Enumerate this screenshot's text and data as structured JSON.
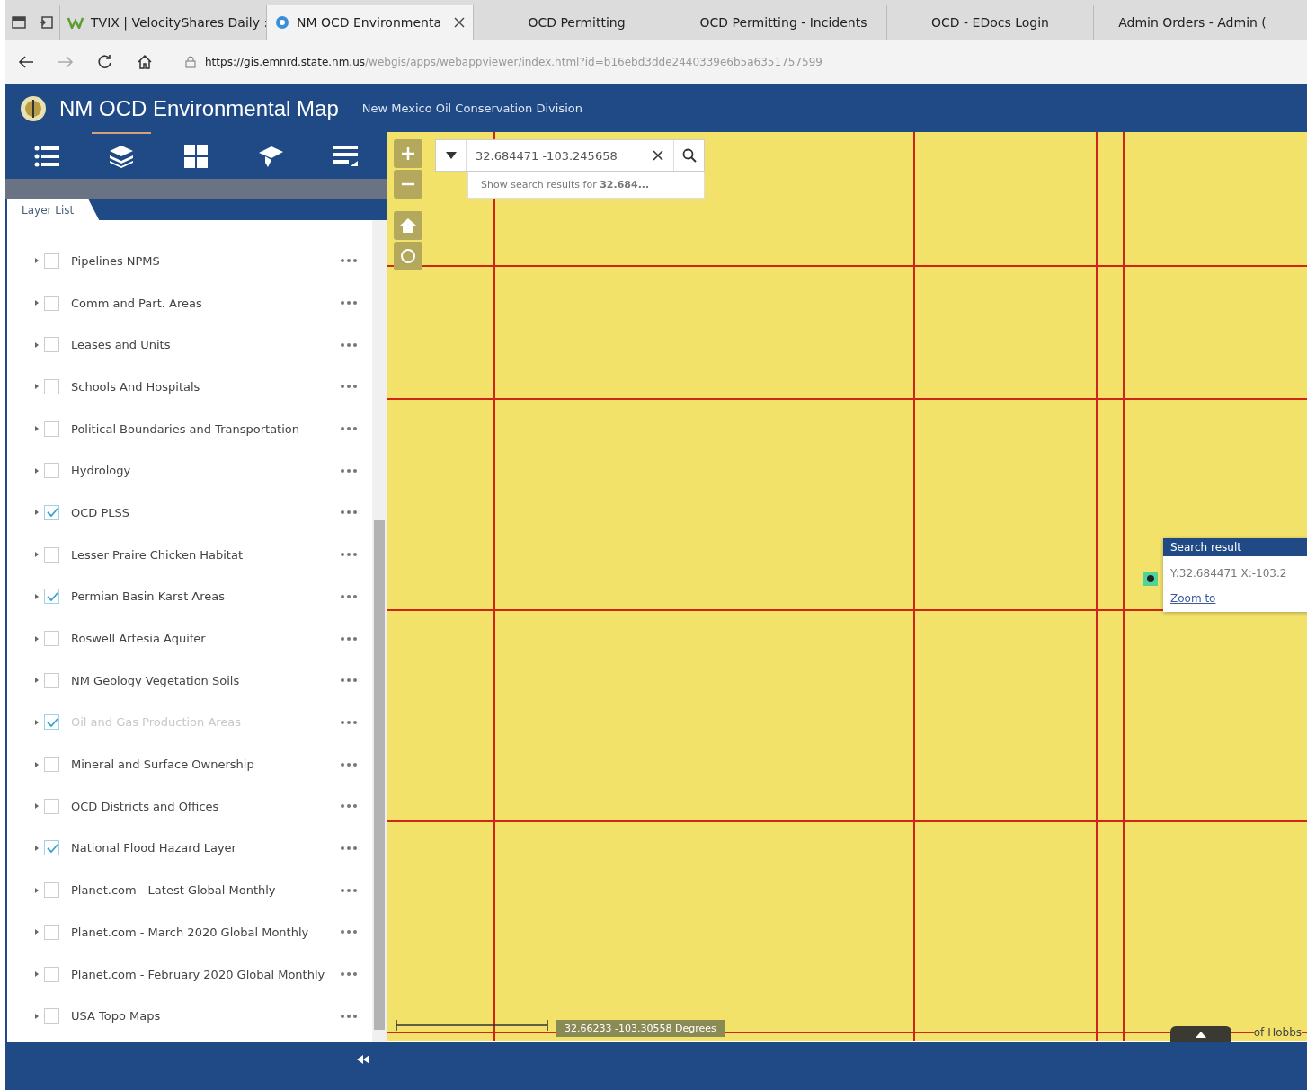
{
  "browser": {
    "tabs": [
      {
        "title": "TVIX | VelocityShares Daily :",
        "selected": false
      },
      {
        "title": "NM OCD Environmenta",
        "selected": true
      },
      {
        "title": "OCD Permitting",
        "selected": false
      },
      {
        "title": "OCD Permitting - Incidents",
        "selected": false
      },
      {
        "title": "OCD - EDocs Login",
        "selected": false
      },
      {
        "title": "Admin Orders - Admin (",
        "selected": false
      }
    ],
    "url_host": "https://gis.emnrd.state.nm.us",
    "url_path": "/webgis/apps/webappviewer/index.html?id=b16ebd3dde2440339e6b5a6351757599"
  },
  "app": {
    "title": "NM OCD Environmental Map",
    "subtitle": "New Mexico Oil Conservation Division"
  },
  "toolbar": [
    {
      "kind": "list",
      "selected": false
    },
    {
      "kind": "layers",
      "selected": true
    },
    {
      "kind": "grid",
      "selected": false
    },
    {
      "kind": "cap",
      "selected": false
    },
    {
      "kind": "legend",
      "selected": false
    }
  ],
  "panel": {
    "title": "Layer List",
    "layers": [
      {
        "name": "Pipelines NPMS",
        "checked": false,
        "disabled": false
      },
      {
        "name": "Comm and Part. Areas",
        "checked": false,
        "disabled": false
      },
      {
        "name": "Leases and Units",
        "checked": false,
        "disabled": false
      },
      {
        "name": "Schools And Hospitals",
        "checked": false,
        "disabled": false
      },
      {
        "name": "Political Boundaries and Transportation",
        "checked": false,
        "disabled": false
      },
      {
        "name": "Hydrology",
        "checked": false,
        "disabled": false
      },
      {
        "name": "OCD PLSS",
        "checked": true,
        "disabled": false
      },
      {
        "name": "Lesser Praire Chicken Habitat",
        "checked": false,
        "disabled": false
      },
      {
        "name": "Permian Basin Karst Areas",
        "checked": true,
        "disabled": false
      },
      {
        "name": "Roswell Artesia Aquifer",
        "checked": false,
        "disabled": false
      },
      {
        "name": "NM Geology Vegetation Soils",
        "checked": false,
        "disabled": false
      },
      {
        "name": "Oil and Gas Production Areas",
        "checked": true,
        "disabled": true
      },
      {
        "name": "Mineral and Surface Ownership",
        "checked": false,
        "disabled": false
      },
      {
        "name": "OCD Districts and Offices",
        "checked": false,
        "disabled": false
      },
      {
        "name": "National Flood Hazard Layer",
        "checked": true,
        "disabled": false
      },
      {
        "name": "Planet.com - Latest Global Monthly",
        "checked": false,
        "disabled": false
      },
      {
        "name": "Planet.com - March 2020 Global Monthly",
        "checked": false,
        "disabled": false
      },
      {
        "name": "Planet.com - February 2020 Global Monthly",
        "checked": false,
        "disabled": false
      },
      {
        "name": "USA Topo Maps",
        "checked": false,
        "disabled": false
      }
    ]
  },
  "map": {
    "search": {
      "value": "32.684471 -103.245658",
      "suggestion": "Show search results for **32.684...**"
    },
    "popup": {
      "title": "Search result",
      "text": "Y:32.684471 X:-103.2",
      "link": "Zoom to"
    },
    "coordinates": "32.66233 -103.30558 Degrees",
    "attribution": "of Hobbs"
  }
}
